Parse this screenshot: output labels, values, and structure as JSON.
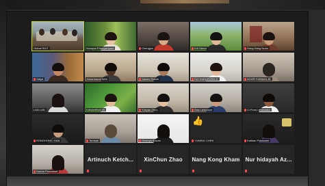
{
  "meeting": {
    "active_speaker": "Global SIUT",
    "accent": "#b9dc1f",
    "muted_color": "#ff4b4b"
  },
  "participants": [
    {
      "name": "Global SIUT",
      "video": true,
      "active": true
    },
    {
      "name": "Worapol Phongsiripant",
      "video": true
    },
    {
      "name": "Chengjun",
      "video": true
    },
    {
      "name": "Krit Saron",
      "video": true
    },
    {
      "name": "Hong Hang Nuon",
      "video": true
    },
    {
      "name": "Gaijai",
      "video": true
    },
    {
      "name": "Xiaranharad Wee",
      "video": true
    },
    {
      "name": "Nawed Rahim",
      "video": true
    },
    {
      "name": "RATSARAPORN S.",
      "video": true
    },
    {
      "name": "NOOR FARAHA JE",
      "video": true
    },
    {
      "name": "LAN LAN",
      "video": true
    },
    {
      "name": "KANANRUETA",
      "video": true
    },
    {
      "name": "Yueyan Zhou",
      "video": true
    },
    {
      "name": "Saw Lawrence",
      "video": true
    },
    {
      "name": "Cl Pond uthaiwatta",
      "video": true
    },
    {
      "name": "RONGHONG XIAN",
      "video": true
    },
    {
      "name": "Terdsak",
      "video": true
    },
    {
      "name": "Giveeya Suwan",
      "video": true
    },
    {
      "name": "YUMING CHEN",
      "video": true,
      "reaction": "thumbs-up"
    },
    {
      "name": "Katikan Pokasami",
      "video": true
    },
    {
      "name": "Nadda Phoowiset",
      "video": true
    },
    {
      "name": "Artinuch Ketch...",
      "video": false
    },
    {
      "name": "XinChun Zhao",
      "video": false
    },
    {
      "name": "Nang Kong Kham",
      "video": false
    },
    {
      "name": "Nur hidayah Az...",
      "video": false
    }
  ],
  "icons": {
    "muted": "mic-muted-icon",
    "reaction": "thumbs-up-icon"
  }
}
